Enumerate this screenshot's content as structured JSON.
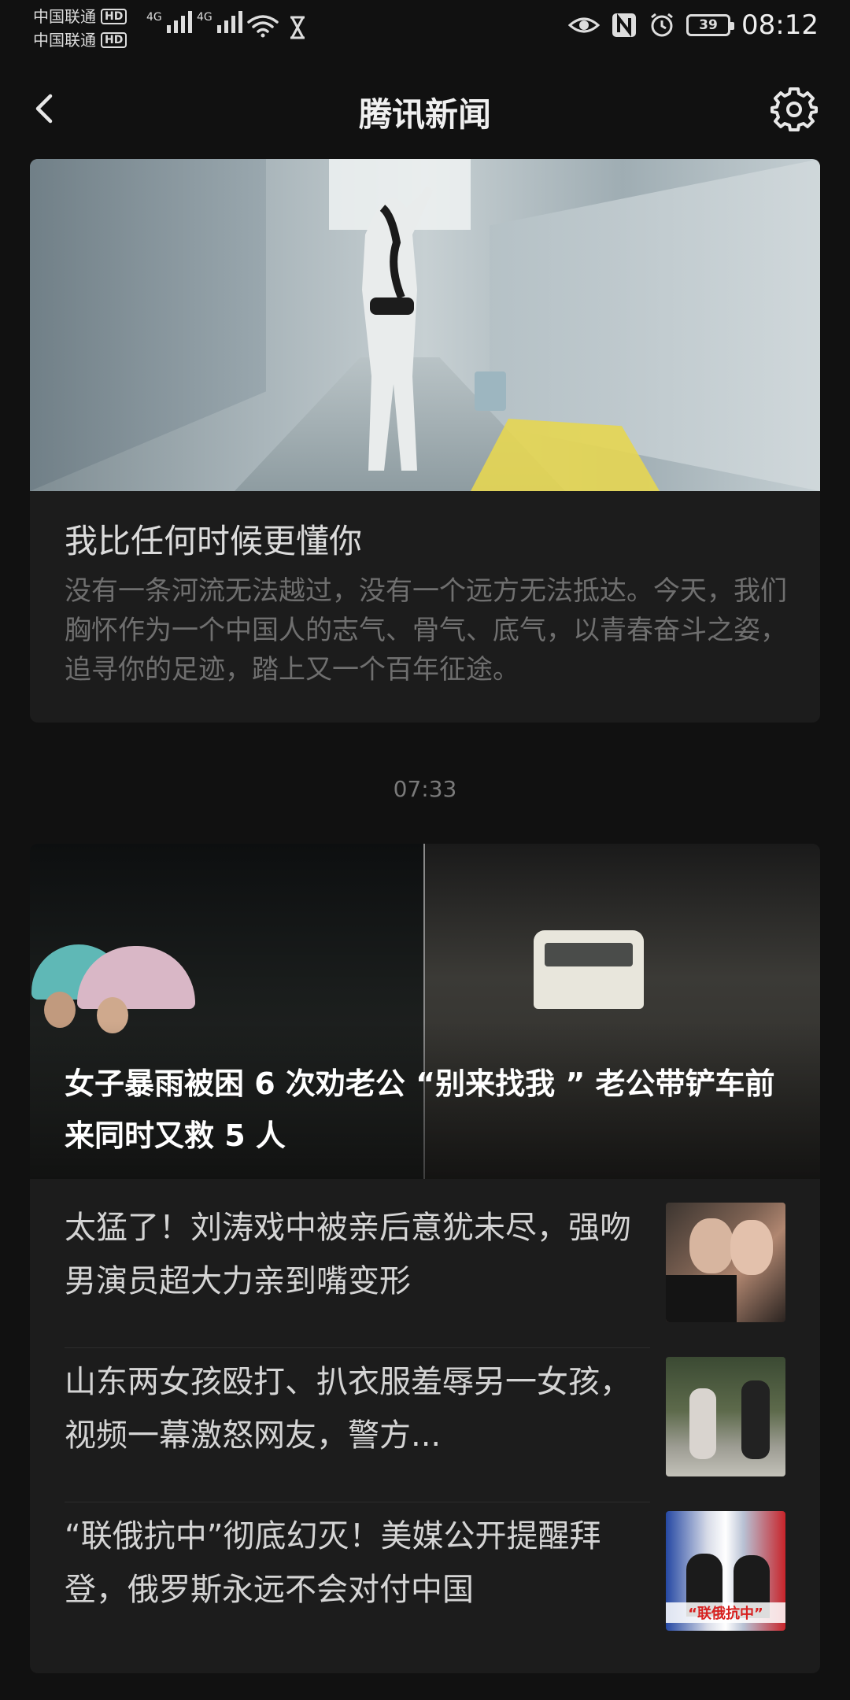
{
  "status_bar": {
    "carrier1": "中国联通",
    "carrier2": "中国联通",
    "hd_badge": "HD",
    "network1": "4G",
    "network2": "4G",
    "battery": "39",
    "time": "08:12"
  },
  "header": {
    "title": "腾讯新闻"
  },
  "card1": {
    "title": "我比任何时候更懂你",
    "description": "没有一条河流无法越过，没有一个远方无法抵达。今天，我们胸怀作为一个中国人的志气、骨气、底气，以青春奋斗之姿，追寻你的足迹，踏上又一个百年征途。"
  },
  "timestamp": "07:33",
  "card2": {
    "headline": "女子暴雨被困 6 次劝老公 “别来找我 ” 老公带铲车前来同时又救 5 人",
    "items": [
      {
        "text": "太猛了！刘涛戏中被亲后意犹未尽，强吻男演员超大力亲到嘴变形"
      },
      {
        "text": "山东两女孩殴打、扒衣服羞辱另一女孩，视频一幕激怒网友，警方..."
      },
      {
        "text": "“联俄抗中”彻底幻灭！美媒公开提醒拜登，俄罗斯永远不会对付中国",
        "thumb_caption": "“联俄抗中”"
      }
    ]
  }
}
